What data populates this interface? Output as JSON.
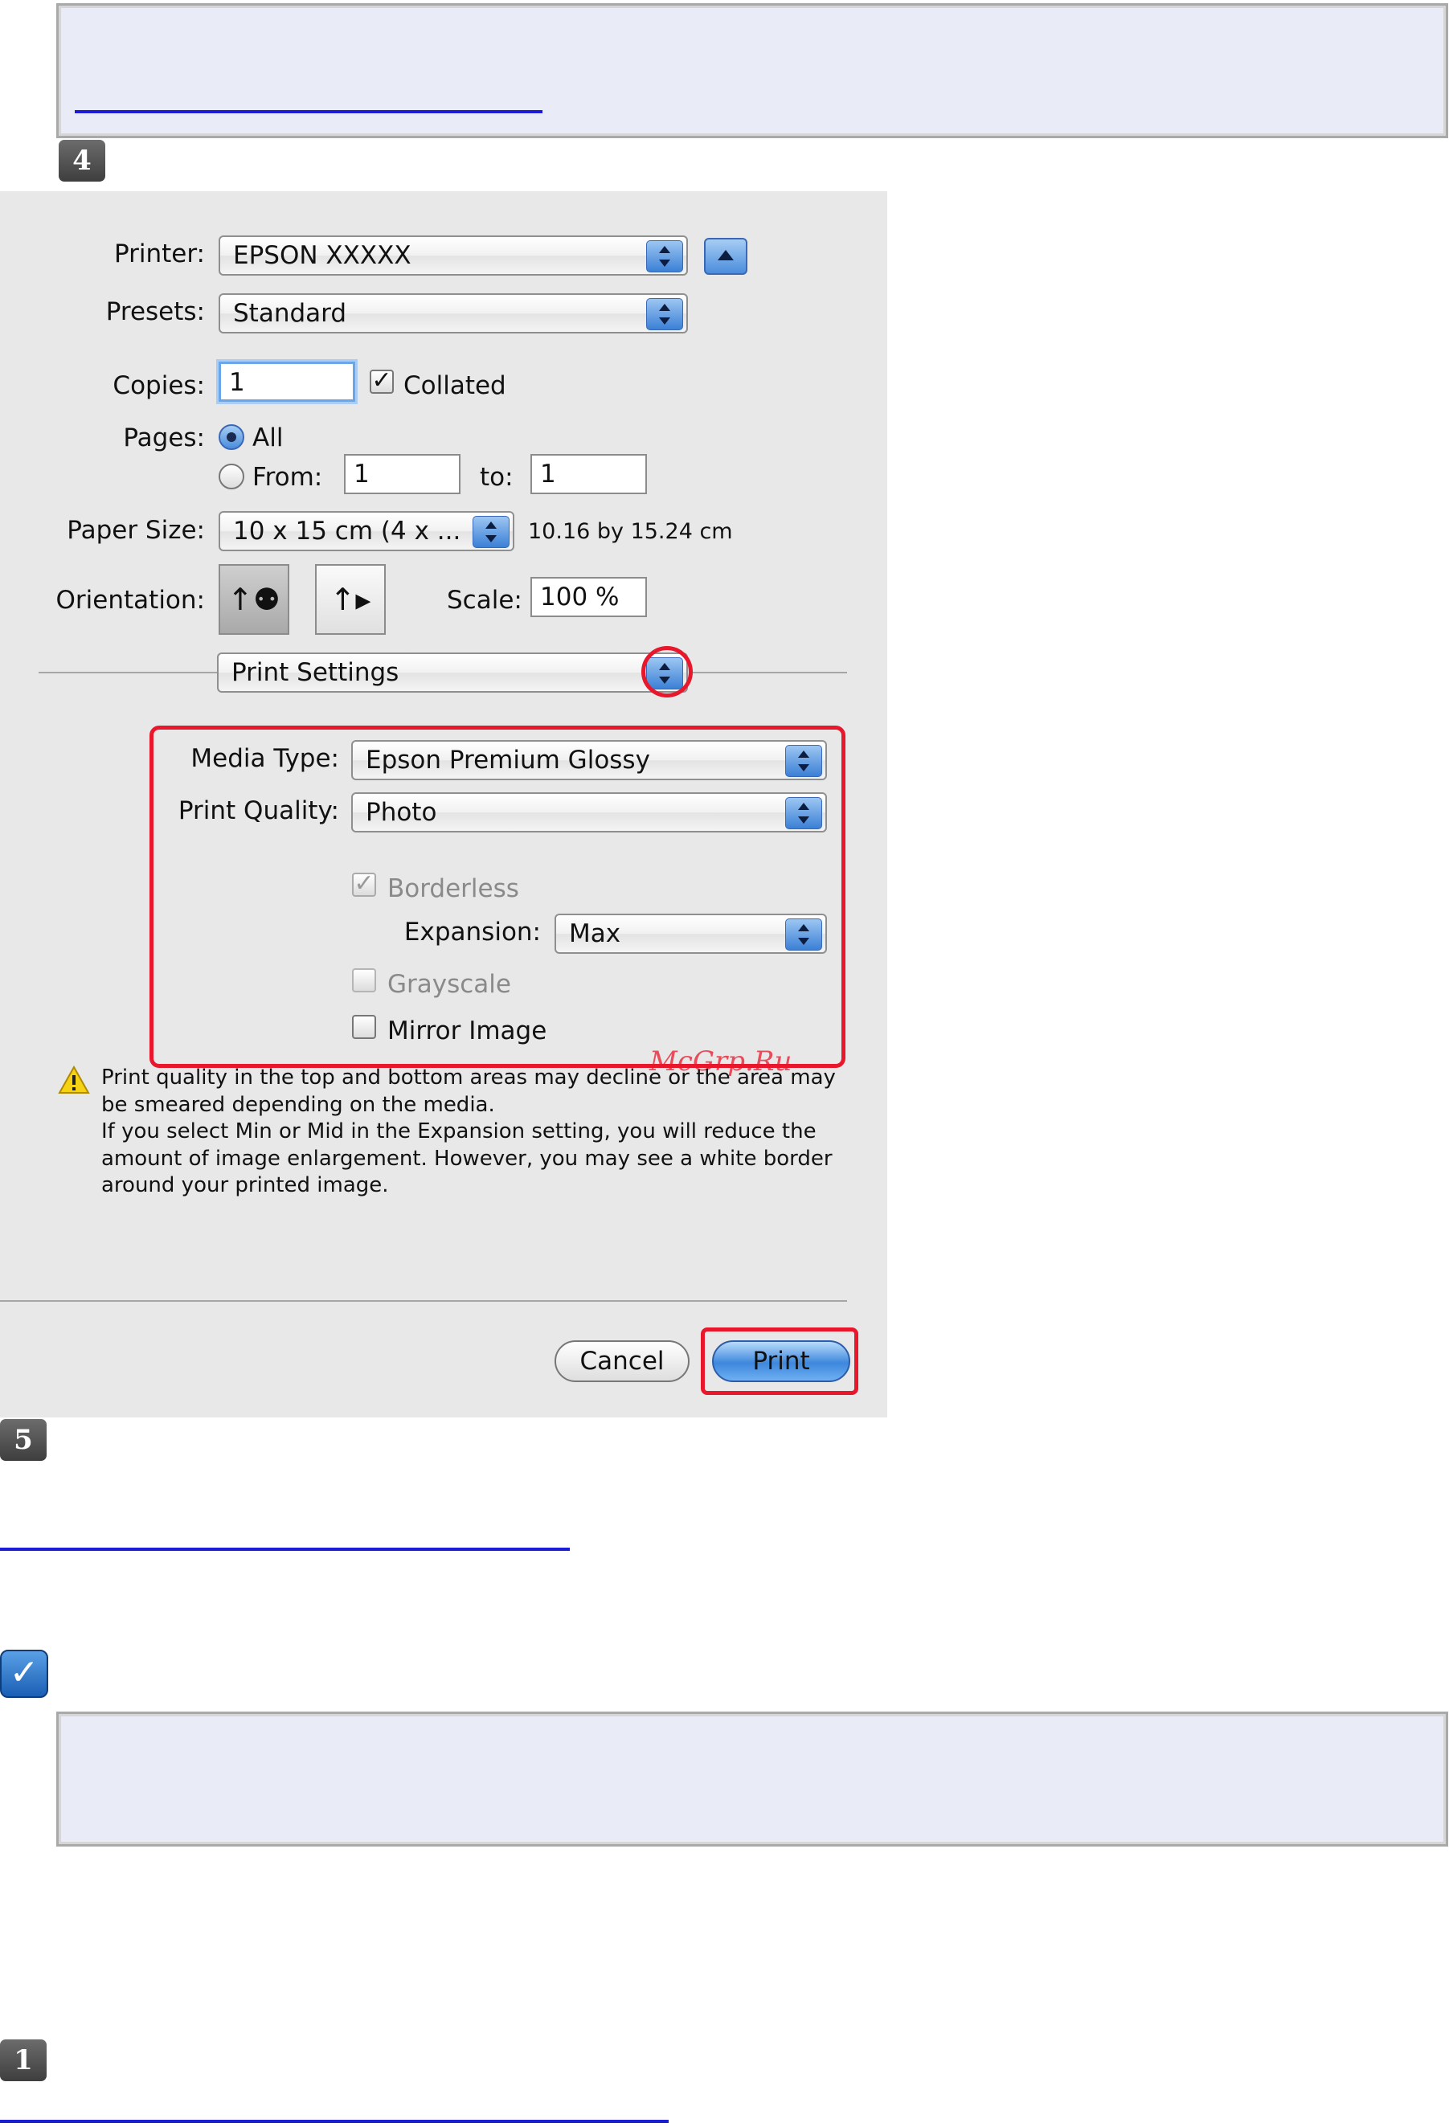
{
  "steps": {
    "step4": "4",
    "step5": "5",
    "step1": "1"
  },
  "dialog": {
    "printer": {
      "label": "Printer:",
      "value": "EPSON XXXXX"
    },
    "presets": {
      "label": "Presets:",
      "value": "Standard"
    },
    "copies": {
      "label": "Copies:",
      "value": "1",
      "collated_label": "Collated",
      "collated_mark": "✓"
    },
    "pages": {
      "label": "Pages:",
      "all_label": "All",
      "from_label": "From:",
      "from_value": "1",
      "to_label": "to:",
      "to_value": "1"
    },
    "paper_size": {
      "label": "Paper Size:",
      "value": "10 x 15 cm (4 x ...",
      "dimensions": "10.16 by 15.24 cm"
    },
    "orientation": {
      "label": "Orientation:"
    },
    "scale": {
      "label": "Scale:",
      "value": "100 %"
    },
    "panel_menu": {
      "value": "Print Settings"
    },
    "media_type": {
      "label": "Media Type:",
      "value": "Epson Premium Glossy"
    },
    "print_quality": {
      "label": "Print Quality:",
      "value": "Photo"
    },
    "borderless": {
      "label": "Borderless",
      "mark": "✓"
    },
    "expansion": {
      "label": "Expansion:",
      "value": "Max"
    },
    "grayscale": {
      "label": "Grayscale"
    },
    "mirror_image": {
      "label": "Mirror Image"
    },
    "warning": {
      "line1": "Print quality in the top and bottom areas may decline or the area may",
      "line2": "be smeared depending on the media.",
      "line3": "If you select Min or Mid in the Expansion setting, you will reduce the",
      "line4": "amount of image enlargement. However, you may see a white border",
      "line5": "around your printed image."
    },
    "buttons": {
      "cancel": "Cancel",
      "print": "Print"
    }
  },
  "watermark": "McGrp.Ru",
  "colors": {
    "highlight_red": "#e8172b",
    "link_blue": "#1c1cd6",
    "note_bg": "#e9ebf6"
  }
}
